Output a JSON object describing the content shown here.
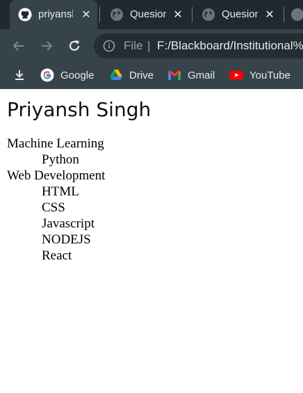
{
  "tabs": [
    {
      "title": "priyansh",
      "icon": "github-icon"
    },
    {
      "title": "Quesion",
      "icon": "globe-icon"
    },
    {
      "title": "Quesion",
      "icon": "globe-icon"
    }
  ],
  "address_bar": {
    "scheme_label": "File",
    "divider": "|",
    "url": "F:/Blackboard/Institutional%"
  },
  "bookmarks": [
    {
      "label": "",
      "icon": "download-icon"
    },
    {
      "label": "Google",
      "icon": "google-icon"
    },
    {
      "label": "Drive",
      "icon": "drive-icon"
    },
    {
      "label": "Gmail",
      "icon": "gmail-icon"
    },
    {
      "label": "YouTube",
      "icon": "youtube-icon"
    }
  ],
  "page": {
    "heading": "Priyansh Singh",
    "skills": {
      "ml": {
        "title": "Machine Learning",
        "items": [
          "Python"
        ]
      },
      "web": {
        "title": "Web Development",
        "items": [
          "HTML",
          "CSS",
          "Javascript",
          "NODEJS",
          "React"
        ]
      }
    }
  },
  "colors": {
    "tabstrip": "#1f2a30",
    "toolbar": "#36434a",
    "omnibox": "#232d32",
    "text_light": "#e8eaed"
  }
}
